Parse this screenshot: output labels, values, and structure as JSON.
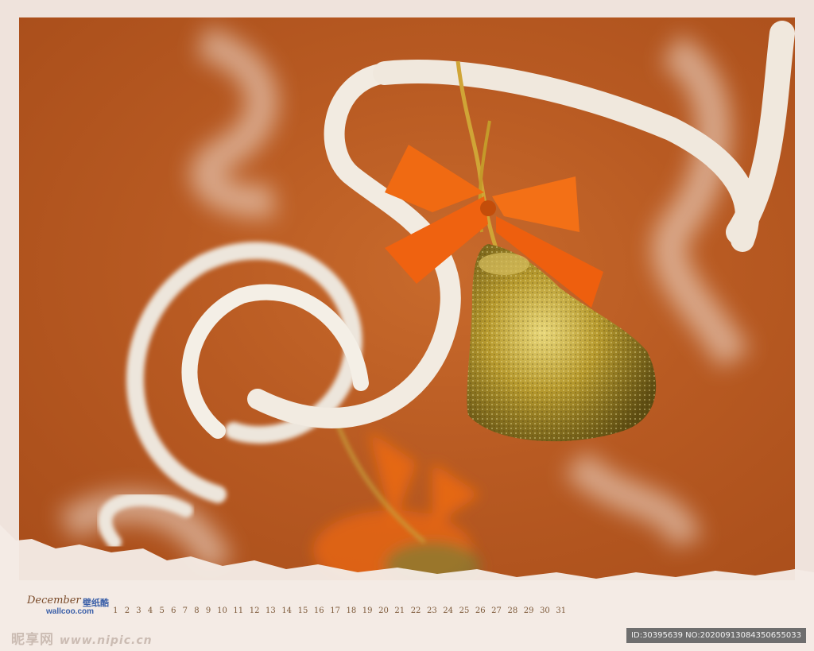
{
  "calendar": {
    "month": "December",
    "label_cn": "壁纸酷",
    "site": "wallcoo.com",
    "days": [
      "1",
      "2",
      "3",
      "4",
      "5",
      "6",
      "7",
      "8",
      "9",
      "10",
      "11",
      "12",
      "13",
      "14",
      "15",
      "16",
      "17",
      "18",
      "19",
      "20",
      "21",
      "22",
      "23",
      "24",
      "25",
      "26",
      "27",
      "28",
      "29",
      "30",
      "31"
    ]
  },
  "watermark": {
    "brand": "昵享网",
    "url": "www.nipic.cn"
  },
  "image_id": "ID:30395639 NO:20200913084350655033",
  "colors": {
    "background": "#b85a22",
    "bell": "#b79a2e",
    "bow": "#f06a12",
    "ribbon": "#ede6dc",
    "frame": "#efe3dc"
  }
}
